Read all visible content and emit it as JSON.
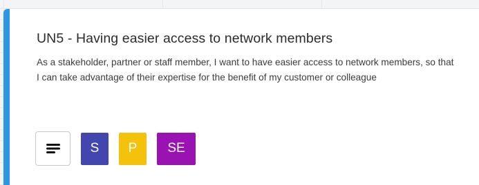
{
  "card": {
    "accent_color": "#2f96e6",
    "title": "UN5 - Having easier access to network members",
    "description": "As a stakeholder, partner or staff member, I want to have easier access to network members, so that I can take advantage of their expertise for the benefit of my customer or colleague"
  },
  "actions": {
    "menu_icon": "text-lines-icon",
    "tags": [
      {
        "label": "S",
        "color": "#4446b0"
      },
      {
        "label": "P",
        "color": "#f5c20b"
      },
      {
        "label": "SE",
        "color": "#9a12b2"
      }
    ]
  }
}
